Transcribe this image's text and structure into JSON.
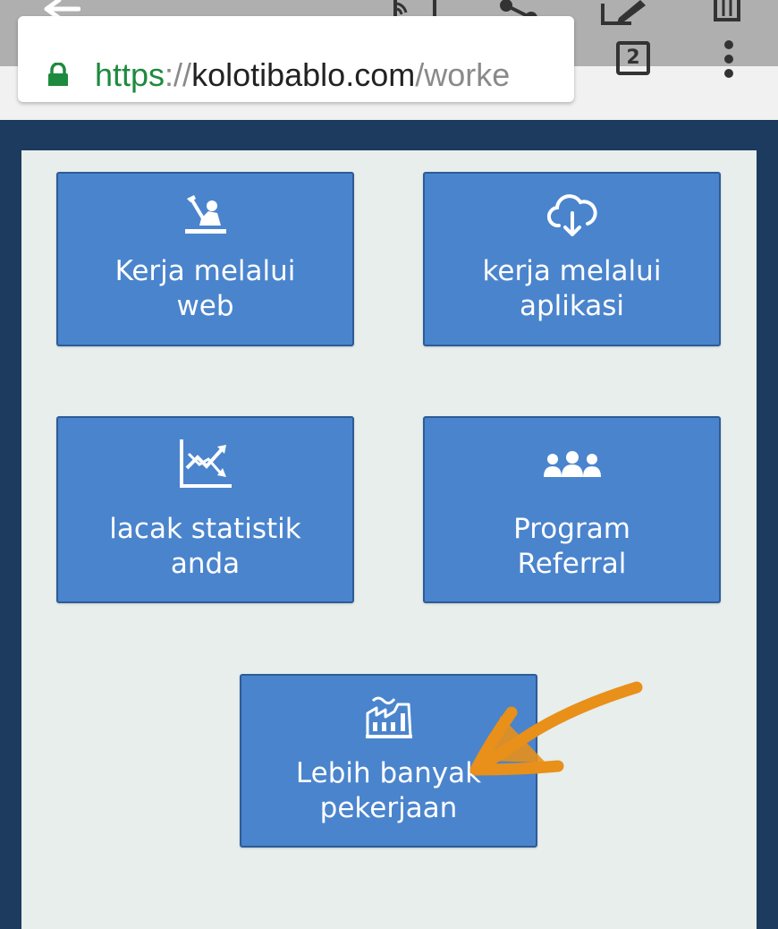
{
  "browser": {
    "url_scheme": "https",
    "url_separator": "://",
    "url_host": "kolotibablo.com",
    "url_path": "/worke",
    "tab_count": "2",
    "secure_color": "#1e8a3e"
  },
  "tiles": [
    {
      "icon": "worker-hammer-icon",
      "line1": "Kerja melalui",
      "line2": "web"
    },
    {
      "icon": "cloud-download-icon",
      "line1": "kerja melalui",
      "line2": "aplikasi"
    },
    {
      "icon": "stats-chart-icon",
      "line1": "lacak statistik",
      "line2": "anda"
    },
    {
      "icon": "people-group-icon",
      "line1": "Program",
      "line2": "Referral"
    },
    {
      "icon": "factory-icon",
      "line1": "Lebih banyak",
      "line2": "pekerjaan"
    }
  ],
  "colors": {
    "tile_bg": "#4a84cd",
    "panel_bg": "#e7eeec",
    "page_bg": "#1d3b5e",
    "annotation_arrow": "#e8901a"
  }
}
